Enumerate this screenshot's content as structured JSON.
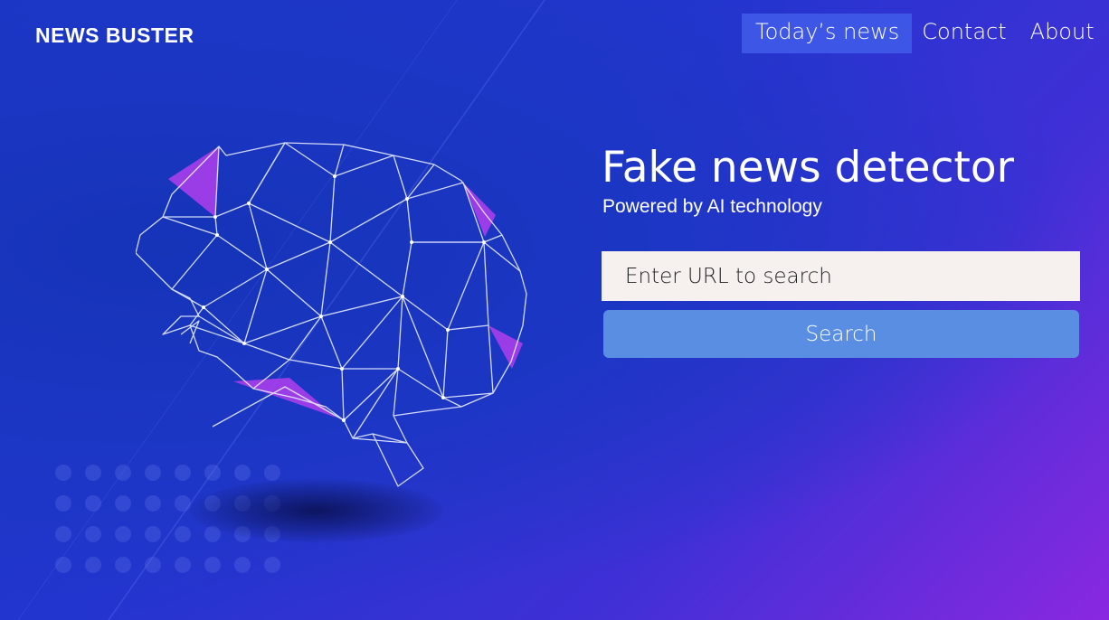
{
  "header": {
    "brand": "NEWS BUSTER",
    "nav": [
      {
        "label": "Today’s news",
        "active": true
      },
      {
        "label": "Contact",
        "active": false
      },
      {
        "label": "About",
        "active": false
      }
    ]
  },
  "hero": {
    "title": "Fake news detector",
    "subtitle": "Powered by AI technology",
    "illustration": "polygonal-brain-icon"
  },
  "search": {
    "placeholder": "Enter URL to search",
    "value": "",
    "button_label": "Search"
  },
  "colors": {
    "background_start": "#1a35c6",
    "background_end": "#8a28e0",
    "nav_active": "#3d56e6",
    "input_bg": "#f6f0ef",
    "button_bg": "#5a8ee3",
    "accent_purple": "#a23ee8"
  }
}
